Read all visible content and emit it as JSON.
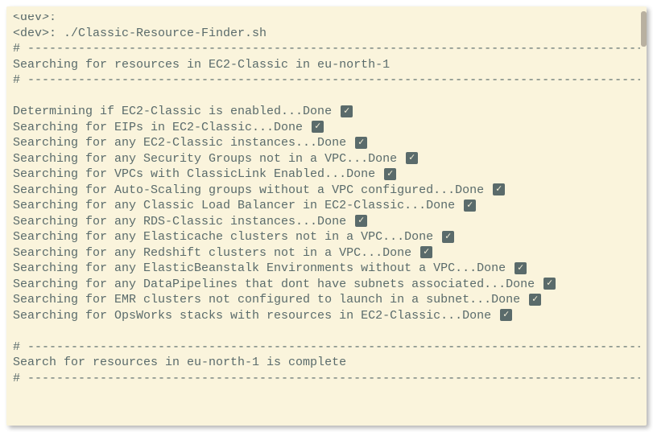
{
  "prompt1": "<dev>:",
  "prompt2": "<dev>: ./Classic-Resource-Finder.sh",
  "divider": "# ------------------------------------------------------------------------------------------",
  "header": "Searching for resources in EC2-Classic in eu-north-1",
  "footer": "Search for resources in eu-north-1 is complete",
  "check_icon": "✓",
  "tasks": [
    "Determining if EC2-Classic is enabled...Done",
    "Searching for EIPs in EC2-Classic...Done",
    "Searching for any EC2-Classic instances...Done",
    "Searching for any Security Groups not in a VPC...Done",
    "Searching for VPCs with ClassicLink Enabled...Done",
    "Searching for Auto-Scaling groups without a VPC configured...Done",
    "Searching for any Classic Load Balancer in EC2-Classic...Done",
    "Searching for any RDS-Classic instances...Done",
    "Searching for any Elasticache clusters not in a VPC...Done",
    "Searching for any Redshift clusters not in a VPC...Done",
    "Searching for any ElasticBeanstalk Environments without a VPC...Done",
    "Searching for any DataPipelines that dont have subnets associated...Done",
    "Searching for EMR clusters not configured to launch in a subnet...Done",
    "Searching for OpsWorks stacks with resources in EC2-Classic...Done"
  ]
}
